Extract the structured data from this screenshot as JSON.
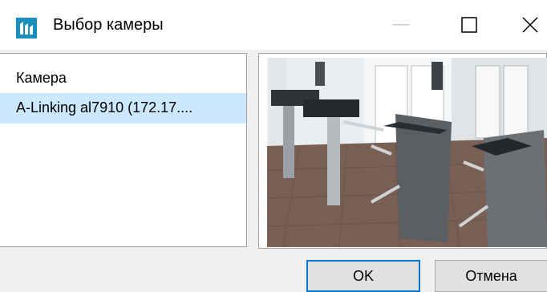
{
  "window": {
    "title": "Выбор камеры",
    "icon": "turnstile-app-icon"
  },
  "camera_list": {
    "header": "Камера",
    "items": [
      {
        "label": "A-Linking al7910 (172.17....",
        "selected": true
      }
    ]
  },
  "preview": {
    "description_icon": "camera-preview-image"
  },
  "buttons": {
    "ok": "OK",
    "cancel": "Отмена"
  },
  "colors": {
    "selection": "#cce8ff",
    "accent": "#0078d7",
    "app_icon": "#1a8fbf"
  }
}
